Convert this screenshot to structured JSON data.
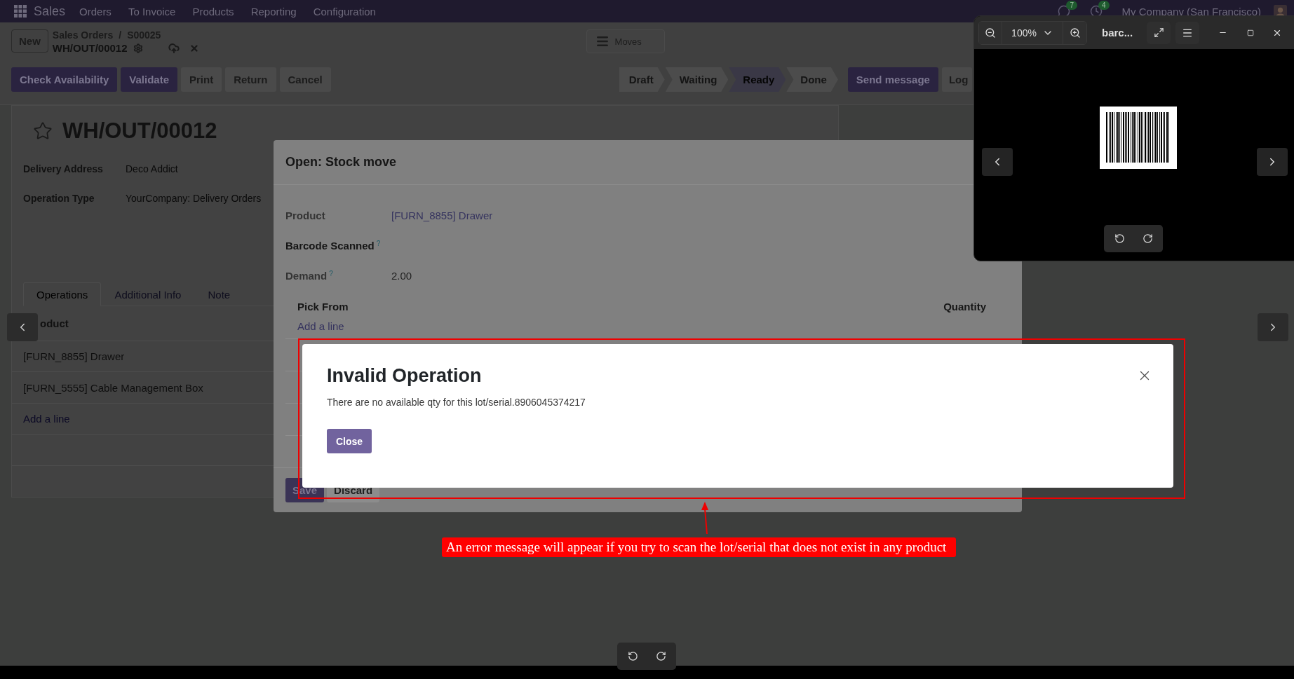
{
  "navbar": {
    "app": "Sales",
    "menu": [
      "Orders",
      "To Invoice",
      "Products",
      "Reporting",
      "Configuration"
    ],
    "chat_count": "7",
    "activity_count": "4",
    "company": "My Company (San Francisco)"
  },
  "control_panel": {
    "new_button": "New",
    "breadcrumbs": [
      "Sales Orders",
      "S00025"
    ],
    "separator": "/",
    "record": "WH/OUT/00012",
    "view_button": "Moves"
  },
  "actions": [
    {
      "label": "Check Availability",
      "primary": true
    },
    {
      "label": "Validate",
      "primary": true
    },
    {
      "label": "Print",
      "primary": false
    },
    {
      "label": "Return",
      "primary": false
    },
    {
      "label": "Cancel",
      "primary": false
    }
  ],
  "status_bar": [
    {
      "label": "Draft",
      "selected": false
    },
    {
      "label": "Waiting",
      "selected": false
    },
    {
      "label": "Ready",
      "selected": true
    },
    {
      "label": "Done",
      "selected": false
    }
  ],
  "chatter_buttons": [
    {
      "label": "Send message",
      "primary": true
    },
    {
      "label": "Log",
      "primary": false
    }
  ],
  "form": {
    "title": "WH/OUT/00012",
    "starred": false,
    "fields": [
      {
        "label": "Delivery Address",
        "value": "Deco Addict"
      },
      {
        "label": "Operation Type",
        "value": "YourCompany: Delivery Orders"
      }
    ],
    "tabs": [
      {
        "label": "Operations",
        "selected": true
      },
      {
        "label": "Additional Info",
        "selected": false
      },
      {
        "label": "Note",
        "selected": false
      }
    ],
    "list_header": "oduct",
    "lines": [
      "[FURN_8855] Drawer",
      "[FURN_5555] Cable Management Box"
    ],
    "add_line": "Add a line"
  },
  "stock_move_dialog": {
    "title": "Open: Stock move",
    "fields": [
      {
        "label": "Product",
        "value": "[FURN_8855] Drawer",
        "kind": "link"
      },
      {
        "label": "Barcode Scanned",
        "hint": "?",
        "kind": "bold"
      },
      {
        "label": "Demand",
        "value": "2.00",
        "hint": "?",
        "kind": "plain"
      }
    ],
    "columns": [
      "Pick From",
      "Quantity"
    ],
    "add_line": "Add a line",
    "buttons": [
      {
        "label": "Save",
        "primary": true
      },
      {
        "label": "Discard",
        "primary": false
      }
    ]
  },
  "error_dialog": {
    "title": "Invalid Operation",
    "message": "There are no available qty for this lot/serial.8906045374217",
    "button": "Close"
  },
  "annotation": {
    "text": "An error message will appear if you try to scan the lot/serial that does not exist in any product"
  },
  "viewer": {
    "zoom": "100%",
    "file_name": "barc..."
  }
}
